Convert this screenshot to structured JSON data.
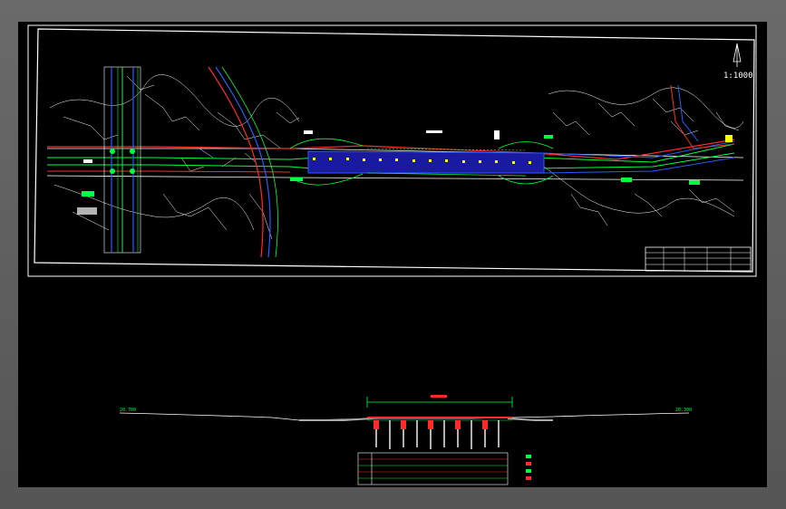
{
  "viewport": {
    "background": "#000000",
    "frame_color": "#5b5b5b"
  },
  "plan": {
    "scale_text": "1:1000",
    "north_arrow_icon": "north-arrow-icon",
    "road_color": "#ffffff",
    "centerline_color": "#ff2a2a",
    "secondary_line_color": "#2a5cff",
    "curb_color": "#00ff3c",
    "bridge_deck_color": "#2a2aff",
    "station_marker_color": "#ffff00"
  },
  "profile": {
    "left_elev": "20.700",
    "right_elev": "20.300",
    "deck_color": "#ff2a2a",
    "pier_color": "#ffffff"
  },
  "colors": {
    "white": "#ffffff",
    "green": "#00ff3c",
    "red": "#ff2a2a",
    "blue": "#2a5cff",
    "yellow": "#ffff00",
    "cyan": "#00ffff"
  }
}
